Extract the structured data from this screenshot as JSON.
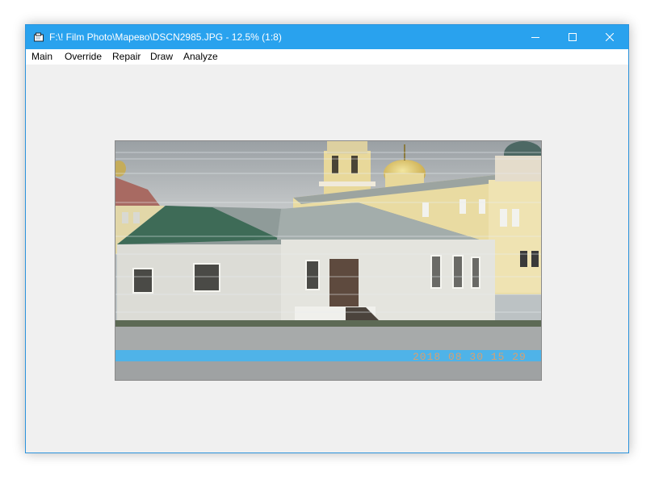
{
  "window": {
    "title": "F:\\! Film Photo\\Марево\\DSCN2985.JPG - 12.5% (1:8)",
    "accent_color": "#29a2ee"
  },
  "title_buttons": {
    "minimize_icon": "minimize-icon",
    "maximize_icon": "maximize-icon",
    "close_icon": "close-icon"
  },
  "menu": {
    "items": [
      "Main",
      "Override",
      "Repair",
      "Draw",
      "Analyze"
    ]
  },
  "image": {
    "date_stamp": "2018 08 30 15 29",
    "stamp_color": "#d8a070",
    "band_color": "#4fb3e8"
  }
}
